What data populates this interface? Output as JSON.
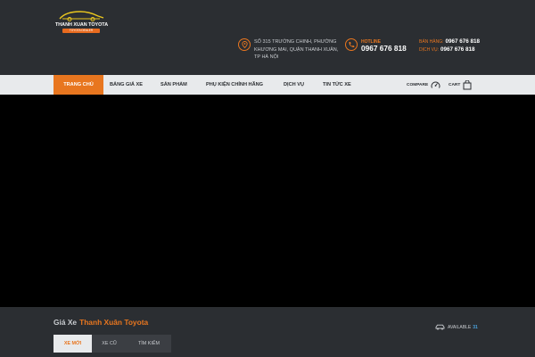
{
  "brand": {
    "name": "THANH XUAN TOYOTA",
    "subtitle": "TOYOTA DEALER"
  },
  "contact": {
    "address": "SỐ 315 TRƯỜNG CHINH, PHƯỜNG KHƯƠNG MAI, QUẬN THANH XUÂN, TP HÀ NỘI",
    "hotline_label": "HOTLINE",
    "hotline_number": "0967 676 818",
    "sales_label": "BÁN HÀNG:",
    "sales_number": "0967 676 818",
    "service_label": "DỊCH VỤ:",
    "service_number": "0967 676 818"
  },
  "nav": {
    "items": [
      {
        "label": "TRANG CHỦ",
        "active": true
      },
      {
        "label": "BẢNG GIÁ XE",
        "active": false
      },
      {
        "label": "SẢN PHẨM",
        "active": false
      },
      {
        "label": "PHỤ KIỆN CHÍNH HÃNG",
        "active": false
      },
      {
        "label": "DỊCH VỤ",
        "active": false
      },
      {
        "label": "TIN TỨC XE",
        "active": false
      }
    ],
    "compare_label": "COMPARE",
    "cart_label": "CART"
  },
  "inventory": {
    "title_prefix": "Giá Xe",
    "title_highlight": "Thanh Xuân Toyota",
    "available_label": "AVAILABLE",
    "available_count": "31",
    "tabs": [
      {
        "label": "XE MỚI",
        "active": true
      },
      {
        "label": "XE CŨ",
        "active": false
      },
      {
        "label": "TÌM KIẾM",
        "active": false
      }
    ]
  },
  "colors": {
    "accent": "#e8761f",
    "header_bg": "#2b2e32",
    "nav_bg": "#e8eaec",
    "count_blue": "#4aa3df"
  }
}
